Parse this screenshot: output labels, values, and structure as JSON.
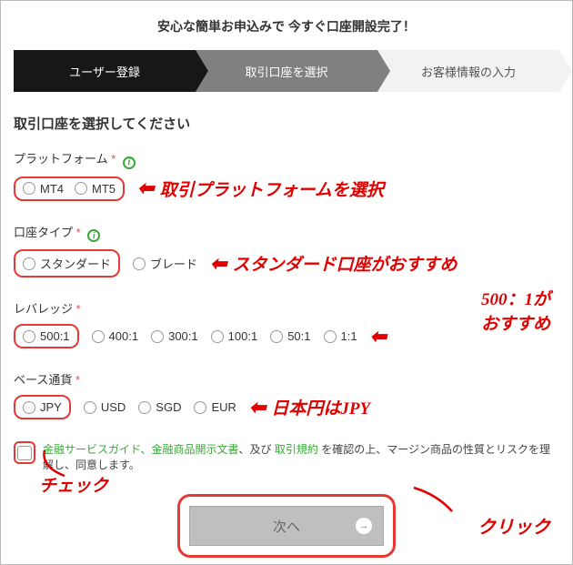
{
  "title": "安心な簡単お申込みで 今すぐ口座開設完了！",
  "steps": {
    "s1": "ユーザー登録",
    "s2": "取引口座を選択",
    "s3": "お客様情報の入力"
  },
  "heading": "取引口座を選択してください",
  "platform": {
    "label": "プラットフォーム",
    "req": "*",
    "options": [
      "MT4",
      "MT5"
    ],
    "annotation": "取引プラットフォームを選択"
  },
  "account_type": {
    "label": "口座タイプ",
    "req": "*",
    "options": [
      "スタンダード",
      "ブレード"
    ],
    "annotation": "スタンダード口座がおすすめ"
  },
  "leverage": {
    "label": "レバレッジ",
    "req": "*",
    "options": [
      "500:1",
      "400:1",
      "300:1",
      "100:1",
      "50:1",
      "1:1"
    ],
    "annotation_l1": "500：1が",
    "annotation_l2": "おすすめ"
  },
  "base_currency": {
    "label": "ベース通貨",
    "req": "*",
    "options": [
      "JPY",
      "USD",
      "SGD",
      "EUR"
    ],
    "annotation": "日本円はJPY"
  },
  "agree": {
    "link1": "金融サービスガイド、金融商品開示文書",
    "mid": "、及び ",
    "link2": "取引規約",
    "tail": " を確認の上、マージン商品の性質とリスクを理解し、同意します。"
  },
  "next": {
    "label": "次へ"
  },
  "ann_check": "チェック",
  "ann_click": "クリック",
  "arrow": "⬅"
}
